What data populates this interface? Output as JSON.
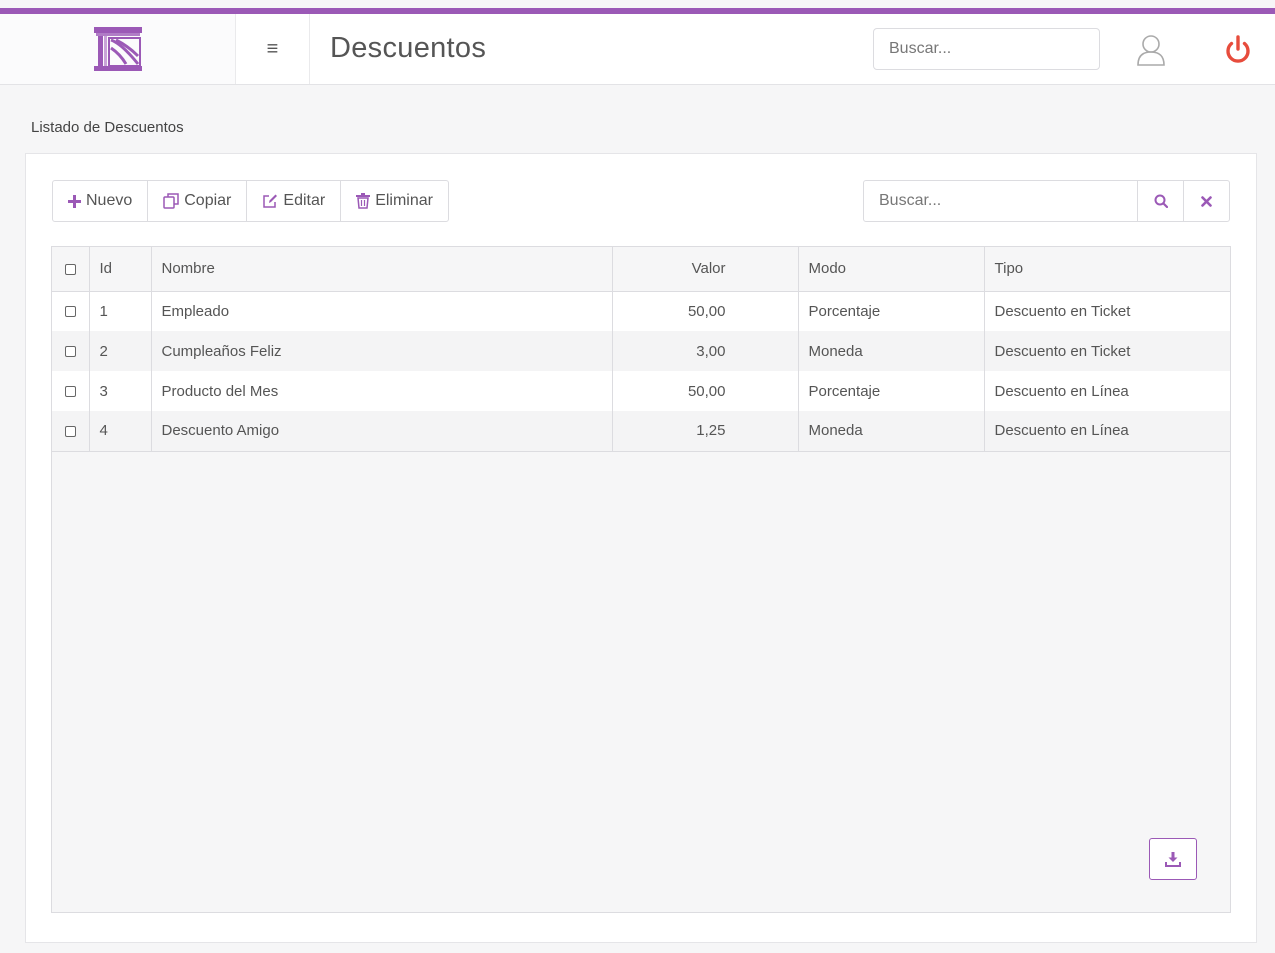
{
  "colors": {
    "accent": "#9b59b6",
    "power": "#e74c3c"
  },
  "header": {
    "logo_icon": "column-logo-icon",
    "menu_icon": "hamburger-icon",
    "menu_glyph": "≡",
    "title": "Descuentos",
    "search_placeholder": "Buscar...",
    "user_icon": "user-icon",
    "power_icon": "power-icon"
  },
  "section": {
    "title": "Listado de Descuentos"
  },
  "toolbar": {
    "nuevo_label": "Nuevo",
    "copiar_label": "Copiar",
    "editar_label": "Editar",
    "eliminar_label": "Eliminar"
  },
  "filter": {
    "placeholder": "Buscar...",
    "search_icon": "search-icon",
    "clear_icon": "close-icon"
  },
  "table": {
    "columns": {
      "id": "Id",
      "nombre": "Nombre",
      "valor": "Valor",
      "modo": "Modo",
      "tipo": "Tipo"
    },
    "rows": [
      {
        "id": "1",
        "nombre": "Empleado",
        "valor": "50,00",
        "modo": "Porcentaje",
        "tipo": "Descuento en Ticket"
      },
      {
        "id": "2",
        "nombre": "Cumpleaños Feliz",
        "valor": "3,00",
        "modo": "Moneda",
        "tipo": "Descuento en Ticket"
      },
      {
        "id": "3",
        "nombre": "Producto del Mes",
        "valor": "50,00",
        "modo": "Porcentaje",
        "tipo": "Descuento en Línea"
      },
      {
        "id": "4",
        "nombre": "Descuento Amigo",
        "valor": "1,25",
        "modo": "Moneda",
        "tipo": "Descuento en Línea"
      }
    ]
  },
  "download": {
    "icon": "download-icon"
  }
}
